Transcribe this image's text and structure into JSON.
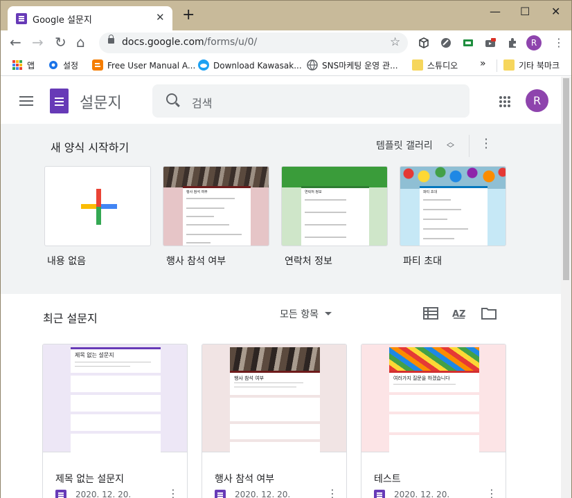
{
  "browser": {
    "tab_title": "Google 설문지",
    "tab_close": "✕",
    "new_tab": "+",
    "window_controls": {
      "minimize": "—",
      "maximize": "☐",
      "close": "✕"
    },
    "url_host": "docs.google.com",
    "url_path": "/forms/u/0/",
    "profile_initial": "R"
  },
  "bookmarks": {
    "items": [
      "앱",
      "설정",
      "Free User Manual A...",
      "Download Kawasak...",
      "SNS마케팅 운영 관...",
      "스튜디오"
    ],
    "overflow": "»",
    "other": "기타 북마크"
  },
  "header": {
    "app_name": "설문지",
    "search_placeholder": "검색",
    "avatar_initial": "R"
  },
  "templates": {
    "heading": "새 양식 시작하기",
    "gallery_label": "템플릿 갤러리",
    "items": [
      {
        "label": "내용 없음"
      },
      {
        "label": "행사 참석 여부",
        "form_title": "행사 참석 여부"
      },
      {
        "label": "연락처 정보",
        "form_title": "연락처 정보"
      },
      {
        "label": "파티 초대",
        "form_title": "파티 초대"
      }
    ]
  },
  "recent": {
    "heading": "최근 설문지",
    "filter_label": "모든 항목",
    "docs": [
      {
        "title": "제목 없는 설문지",
        "date": "2020. 12. 20.",
        "form_title": "제목 없는 설문지"
      },
      {
        "title": "행사 참석 여부",
        "date": "2020. 12. 20.",
        "form_title": "행사 참석 여부"
      },
      {
        "title": "테스트",
        "date": "2020. 12. 20.",
        "form_title": "여러가지 질문을 하겠습니다"
      }
    ]
  },
  "colors": {
    "forms_purple": "#673ab7",
    "google_blue": "#4285f4",
    "google_red": "#ea4335",
    "google_yellow": "#fbbc04",
    "google_green": "#34a853"
  }
}
